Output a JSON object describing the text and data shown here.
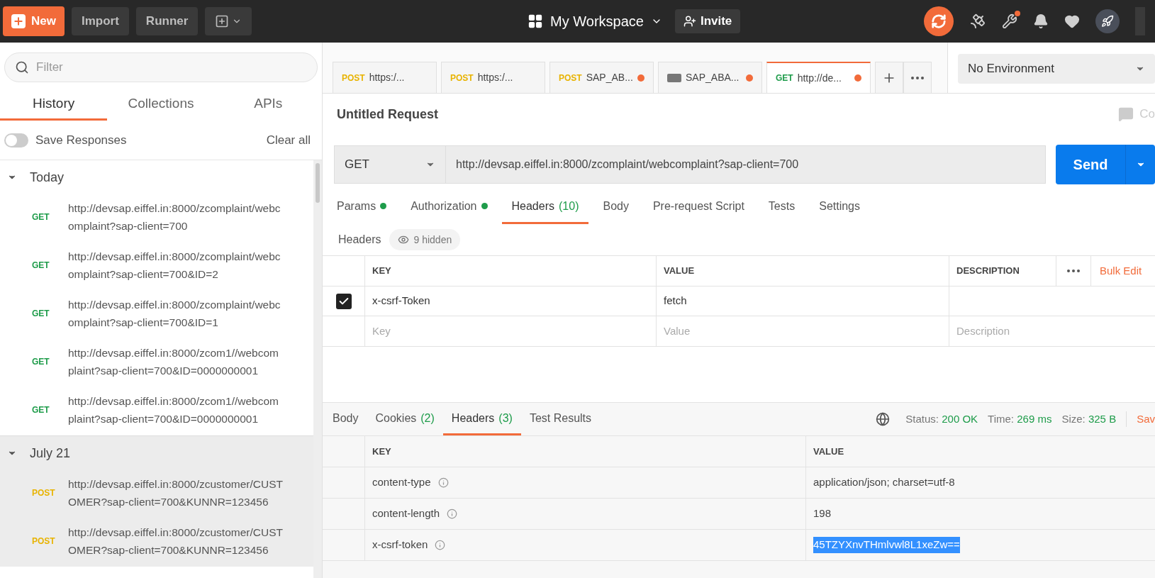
{
  "topbar": {
    "new_button": "New",
    "buttons": [
      "Import",
      "Runner"
    ],
    "workspace": "My Workspace",
    "invite": "Invite"
  },
  "sidebar": {
    "filter_placeholder": "Filter",
    "tabs": [
      {
        "label": "History",
        "selected": true
      },
      {
        "label": "Collections",
        "selected": false
      },
      {
        "label": "APIs",
        "selected": false
      }
    ],
    "save_responses": {
      "label": "Save Responses",
      "on": false
    },
    "clear_all": "Clear all",
    "groups": [
      {
        "title": "Today",
        "expanded": true,
        "items": [
          {
            "method": "GET",
            "url": "http://devsap.eiffel.in:8000/zcomplaint/webcomplaint?sap-client=700"
          },
          {
            "method": "GET",
            "url": "http://devsap.eiffel.in:8000/zcomplaint/webcomplaint?sap-client=700&ID=2"
          },
          {
            "method": "GET",
            "url": "http://devsap.eiffel.in:8000/zcomplaint/webcomplaint?sap-client=700&ID=1"
          },
          {
            "method": "GET",
            "url": "http://devsap.eiffel.in:8000/zcom1//webcomplaint?sap-client=700&ID=0000000001"
          },
          {
            "method": "GET",
            "url": "http://devsap.eiffel.in:8000/zcom1//webcomplaint?sap-client=700&ID=0000000001"
          }
        ]
      },
      {
        "title": "July 21",
        "expanded": true,
        "items": [
          {
            "method": "POST",
            "url": "http://devsap.eiffel.in:8000/zcustomer/CUSTOMER?sap-client=700&KUNNR=123456"
          },
          {
            "method": "POST",
            "url": "http://devsap.eiffel.in:8000/zcustomer/CUSTOMER?sap-client=700&KUNNR=123456"
          }
        ]
      }
    ]
  },
  "request_tabs": [
    {
      "kind": "method",
      "method": "POST",
      "label": "https:/...",
      "unsaved": false,
      "selected": false
    },
    {
      "kind": "method",
      "method": "POST",
      "label": "https:/...",
      "unsaved": false,
      "selected": false
    },
    {
      "kind": "method",
      "method": "POST",
      "label": "SAP_AB...",
      "unsaved": true,
      "selected": false
    },
    {
      "kind": "example",
      "label": "SAP_ABA...",
      "unsaved": true,
      "selected": false
    },
    {
      "kind": "method",
      "method": "GET",
      "label": "http://de...",
      "unsaved": true,
      "selected": true
    }
  ],
  "environment": "No Environment",
  "request": {
    "title": "Untitled Request",
    "comments_cut": "Co",
    "method": "GET",
    "url": "http://devsap.eiffel.in:8000/zcomplaint/webcomplaint?sap-client=700",
    "send": "Send",
    "tabs": [
      {
        "label": "Params",
        "dot": true,
        "selected": false
      },
      {
        "label": "Authorization",
        "dot": true,
        "selected": false
      },
      {
        "label": "Headers",
        "count": "(10)",
        "dot": false,
        "selected": true
      },
      {
        "label": "Body",
        "dot": false,
        "selected": false
      },
      {
        "label": "Pre-request Script",
        "dot": false,
        "selected": false
      },
      {
        "label": "Tests",
        "dot": false,
        "selected": false
      },
      {
        "label": "Settings",
        "dot": false,
        "selected": false
      }
    ],
    "headers_label": "Headers",
    "hidden": "9 hidden",
    "columns": [
      "KEY",
      "VALUE",
      "DESCRIPTION"
    ],
    "bulk_edit": "Bulk Edit",
    "rows": [
      {
        "checked": true,
        "key": "x-csrf-Token",
        "value": "fetch"
      }
    ],
    "new_row": {
      "key": {
        "placeholder": "Key"
      },
      "value": {
        "placeholder": "Value"
      },
      "description": {
        "placeholder": "Description"
      }
    }
  },
  "response": {
    "tabs": [
      {
        "label": "Body",
        "selected": false
      },
      {
        "label": "Cookies",
        "count": "(2)",
        "selected": false
      },
      {
        "label": "Headers",
        "count": "(3)",
        "selected": true
      },
      {
        "label": "Test Results",
        "selected": false
      }
    ],
    "status_label": "Status:",
    "status": "200 OK",
    "time_label": "Time:",
    "time": "269 ms",
    "size_label": "Size:",
    "size": "325 B",
    "save_cut": "Sav",
    "columns": [
      "KEY",
      "VALUE"
    ],
    "rows": [
      {
        "key": "content-type",
        "value": "application/json; charset=utf-8",
        "selected": false
      },
      {
        "key": "content-length",
        "value": "198",
        "selected": false
      },
      {
        "key": "x-csrf-token",
        "value": "45TZYXnvTHmlvwl8L1xeZw==",
        "selected": true
      }
    ]
  }
}
